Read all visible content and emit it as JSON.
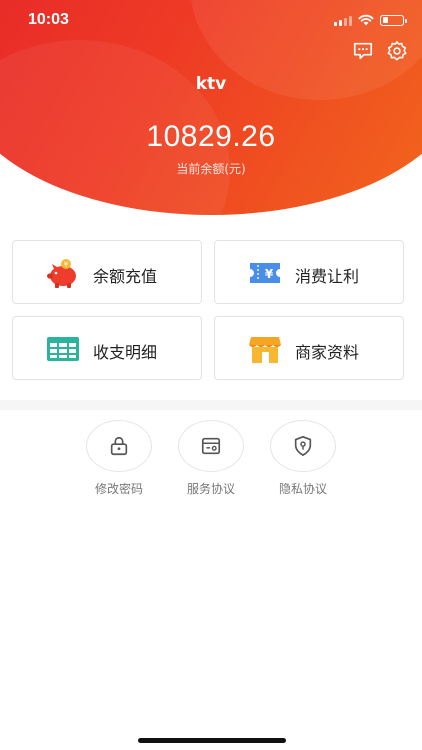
{
  "status_bar": {
    "time": "10:03",
    "battery_level": 0.3
  },
  "header": {
    "title": "ktv",
    "balance": "10829.26",
    "balance_label": "当前余额(元)",
    "icons": [
      "message-icon",
      "gear-icon"
    ]
  },
  "actions": [
    {
      "label": "余额充值",
      "icon": "piggy-bank-icon"
    },
    {
      "label": "消费让利",
      "icon": "coupon-icon"
    },
    {
      "label": "收支明细",
      "icon": "ledger-icon"
    },
    {
      "label": "商家资料",
      "icon": "store-icon"
    }
  ],
  "links": [
    {
      "label": "修改密码",
      "icon": "lock-icon"
    },
    {
      "label": "服务协议",
      "icon": "agreement-icon"
    },
    {
      "label": "隐私协议",
      "icon": "shield-icon"
    }
  ],
  "colors": {
    "brand_start": "#e5242a",
    "brand_end": "#f26a1b"
  }
}
